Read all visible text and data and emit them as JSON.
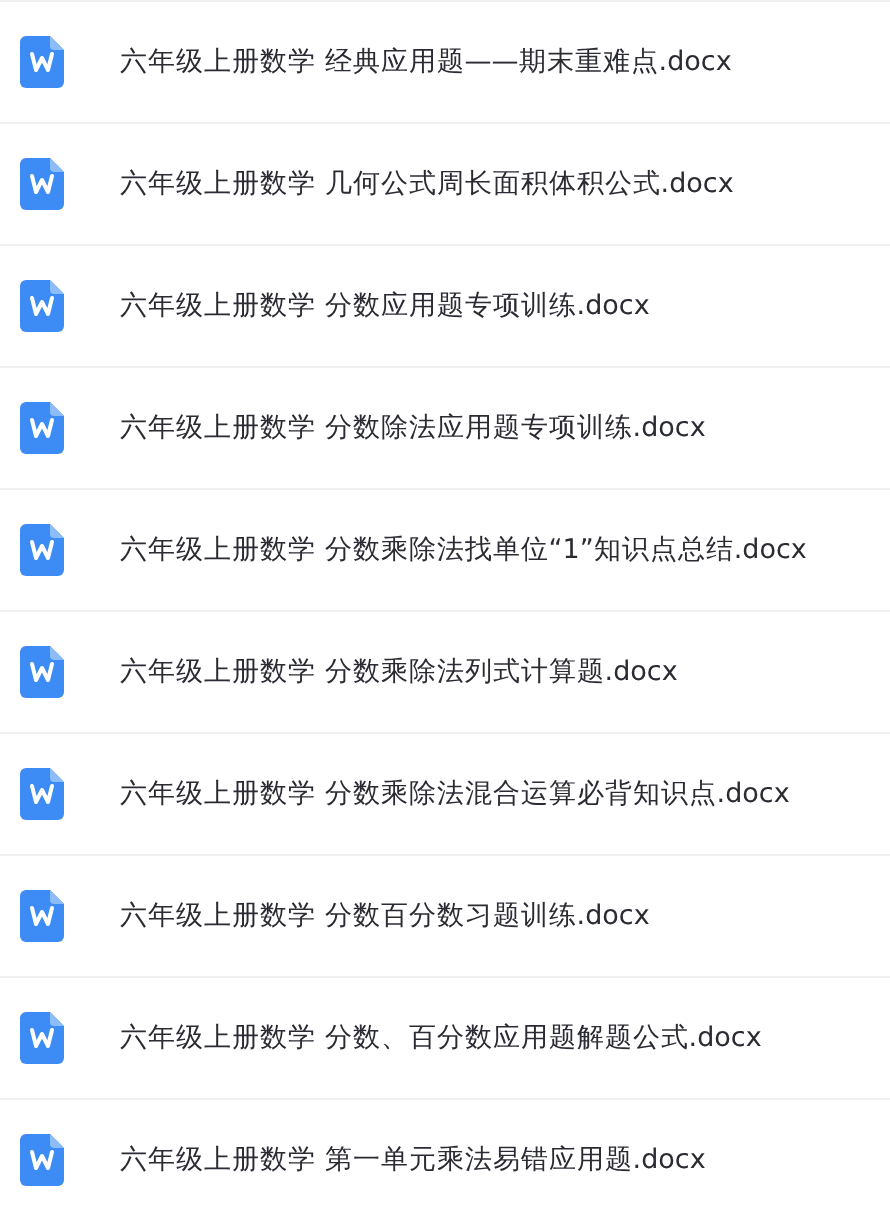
{
  "files": [
    {
      "name": "六年级上册数学 经典应用题——期末重难点.docx"
    },
    {
      "name": "六年级上册数学 几何公式周长面积体积公式.docx"
    },
    {
      "name": "六年级上册数学 分数应用题专项训练.docx"
    },
    {
      "name": "六年级上册数学 分数除法应用题专项训练.docx"
    },
    {
      "name": "六年级上册数学 分数乘除法找单位“1”知识点总结.docx"
    },
    {
      "name": "六年级上册数学 分数乘除法列式计算题.docx"
    },
    {
      "name": "六年级上册数学 分数乘除法混合运算必背知识点.docx"
    },
    {
      "name": "六年级上册数学 分数百分数习题训练.docx"
    },
    {
      "name": "六年级上册数学 分数、百分数应用题解题公式.docx"
    },
    {
      "name": "六年级上册数学 第一单元乘法易错应用题.docx"
    }
  ]
}
